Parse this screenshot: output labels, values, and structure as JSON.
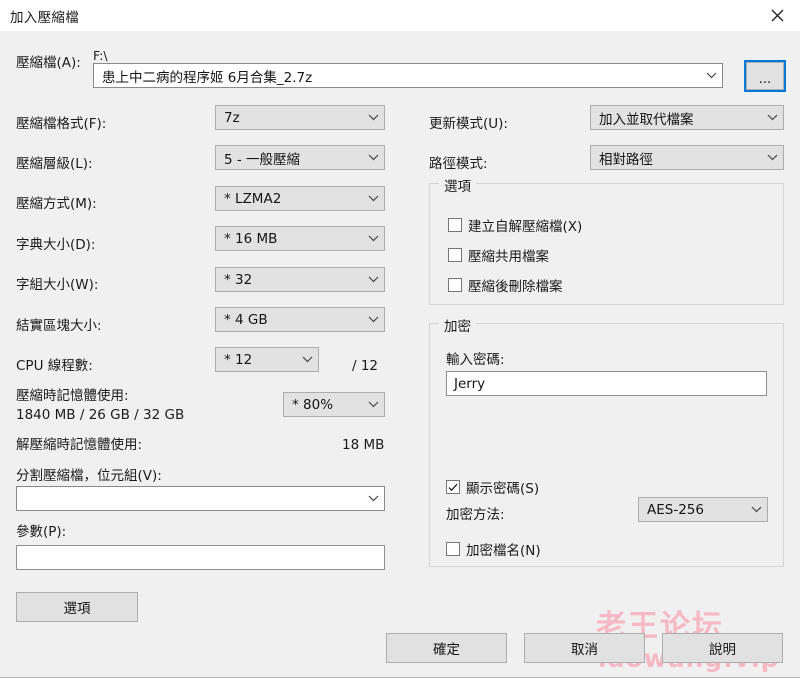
{
  "window": {
    "title": "加入壓縮檔",
    "close_icon": "close-icon"
  },
  "archive": {
    "label": "壓縮檔(A):",
    "path_prefix": "F:\\",
    "filename": "患上中二病的程序姬 6月合集_2.7z",
    "browse_label": "..."
  },
  "left": {
    "format": {
      "label": "壓縮檔格式(F):",
      "value": "7z"
    },
    "level": {
      "label": "壓縮層級(L):",
      "value": "5 - 一般壓縮"
    },
    "method": {
      "label": "壓縮方式(M):",
      "value": "*  LZMA2"
    },
    "dictionary": {
      "label": "字典大小(D):",
      "value": "*  16 MB"
    },
    "word_size": {
      "label": "字組大小(W):",
      "value": "*  32"
    },
    "solid_block": {
      "label": "結實區塊大小:",
      "value": "*  4 GB"
    },
    "cpu_threads": {
      "label": "CPU 線程數:",
      "value": "*  12",
      "total": "/ 12"
    },
    "mem_compress": {
      "label": "壓縮時記憶體使用:",
      "detail": "1840 MB / 26 GB / 32 GB",
      "value": "*  80%"
    },
    "mem_decompress": {
      "label": "解壓縮時記憶體使用:",
      "value": "18 MB"
    },
    "split": {
      "label": "分割壓縮檔，位元組(V):",
      "value": ""
    },
    "parameters": {
      "label": "參數(P):",
      "value": ""
    },
    "options_button": "選項"
  },
  "right": {
    "update_mode": {
      "label": "更新模式(U):",
      "value": "加入並取代檔案"
    },
    "path_mode": {
      "label": "路徑模式:",
      "value": "相對路徑"
    },
    "options_group": {
      "legend": "選項",
      "items": [
        {
          "label": "建立自解壓縮檔(X)",
          "checked": false
        },
        {
          "label": "壓縮共用檔案",
          "checked": false
        },
        {
          "label": "壓縮後刪除檔案",
          "checked": false
        }
      ]
    },
    "encryption_group": {
      "legend": "加密",
      "password_label": "輸入密碼:",
      "password_value": "Jerry",
      "show_password": {
        "label": "顯示密碼(S)",
        "checked": true
      },
      "method_label": "加密方法:",
      "method_value": "AES-256",
      "encrypt_names": {
        "label": "加密檔名(N)",
        "checked": false
      }
    }
  },
  "footer": {
    "ok": "確定",
    "cancel": "取消",
    "help": "說明"
  },
  "watermark": {
    "line1": "老王论坛",
    "line2": "laowang.vip",
    "color": "#f6b9c4"
  }
}
